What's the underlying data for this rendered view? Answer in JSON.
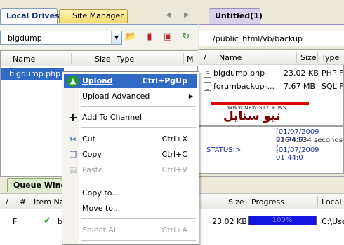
{
  "left_tabs": {
    "local": "Local Drives",
    "site": "Site Manager"
  },
  "left_path": "bigdump",
  "left_columns": {
    "name": "Name",
    "size": "Size",
    "type": "Type",
    "mod": "M"
  },
  "left_file": {
    "name": "bigdump.php"
  },
  "right_tab": "Untitled(1)",
  "right_path": "/public_html/vb/backup",
  "right_columns": {
    "name": "Name",
    "size": "Size",
    "type": "Type"
  },
  "right_files": [
    {
      "name": "bigdump.php",
      "size": "23.02 KB",
      "type": "PHP F"
    },
    {
      "name": "forumbackup-...",
      "size": "7.67 MB",
      "type": "SQL F"
    }
  ],
  "logo": {
    "arabic": "نيو ستايل",
    "url": "WWW.NEW-STYLE.WS"
  },
  "log": {
    "line1_time": "[01/07/2009 01:44:0",
    "line2": "226 4.534 seconds (",
    "status_label": "STATUS:>",
    "line3_time": "[01/07/2009 01:44:0"
  },
  "queue": {
    "tab": "Queue Window",
    "columns": {
      "slash": "/",
      "num": "#",
      "item": "Item Na",
      "size": "Size",
      "progress": "Progress",
      "local": "Local"
    },
    "row": {
      "flag": "F",
      "item": "b",
      "size": "23.02 KB",
      "progress": 100,
      "progress_label": "100%",
      "local": "C:\\Use"
    }
  },
  "menu": {
    "upload": {
      "label": "Upload",
      "shortcut": "Ctrl+PgUp"
    },
    "upload_advanced": "Upload Advanced",
    "add_channel": "Add To Channel",
    "cut": {
      "label": "Cut",
      "shortcut": "Ctrl+X"
    },
    "copy": {
      "label": "Copy",
      "shortcut": "Ctrl+C"
    },
    "paste": {
      "label": "Paste",
      "shortcut": "Ctrl+V"
    },
    "copy_to": "Copy to...",
    "move_to": "Move to...",
    "select_all": {
      "label": "Select All",
      "shortcut": "Ctrl+A"
    }
  },
  "colors": {
    "highlight": "#316ac5",
    "progress": "#1414e0",
    "log_text": "#1530a8"
  }
}
